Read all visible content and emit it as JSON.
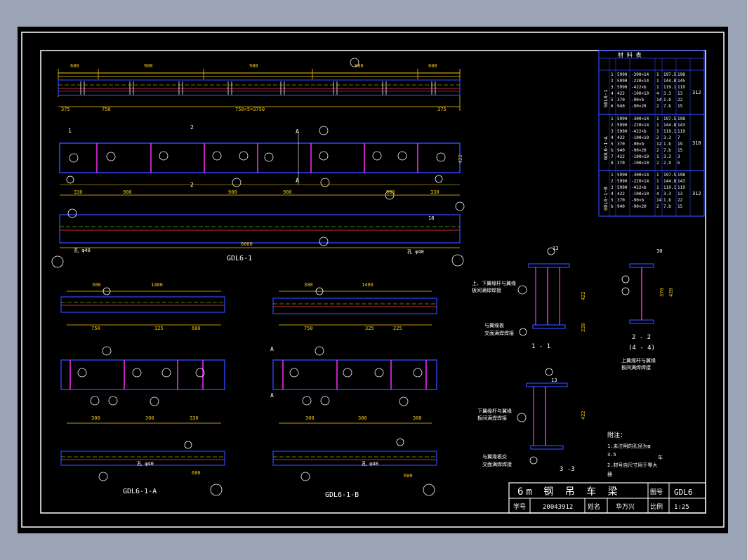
{
  "drawing": {
    "views": {
      "main_label": "GDL6-1",
      "a_label": "GDL6-1-A",
      "b_label": "GDL6-1-B",
      "sec11": "1 - 1",
      "sec22": "2 - 2",
      "sec44": "(4 - 4)",
      "sec33": "3 -3"
    },
    "notes": {
      "title": "附注：",
      "line1": "1.未注明的孔径为φ",
      "line2": "3.5",
      "line2b": "车",
      "line3": "2.材号自尺寸用于零大",
      "line4": "器"
    },
    "callouts": {
      "weld1a": "上、下翼缘杆与翼缘",
      "weld1b": "板间满焊焊接",
      "weld2a": "与翼缘板",
      "weld2b": "交面满焊焊接",
      "weld3a": "上翼缘杆与翼缘",
      "weld3b": "板间满焊焊接",
      "weld4a": "下翼缘杆与翼缘",
      "weld4b": "板间满焊焊接",
      "weld5a": "与翼缘板交",
      "weld5b": "交面满焊焊接",
      "hole": "孔 φ40"
    },
    "table": {
      "title": "材 料 表",
      "groups": [
        "GDL6-1",
        "GDL6-1-A",
        "GDL6-1-B"
      ],
      "group_totals": [
        "312",
        "310",
        "312"
      ],
      "rows_g1": [
        [
          "1",
          "5990",
          "-300×14",
          "1",
          "197.5",
          "198"
        ],
        [
          "2",
          "5990",
          "-220×14",
          "1",
          "144.8",
          "145"
        ],
        [
          "3",
          "5990",
          "-422×b",
          "1",
          "119.1",
          "119"
        ],
        [
          "4",
          "422",
          "-100×10",
          "4",
          "3.3",
          "13"
        ],
        [
          "5",
          "370",
          "-90×b",
          "14",
          "1.b",
          "22"
        ],
        [
          "6",
          "940",
          "-90×20",
          "2",
          "7.b",
          "15"
        ]
      ],
      "rows_g2": [
        [
          "1",
          "5990",
          "-300×14",
          "1",
          "197.5",
          "198"
        ],
        [
          "2",
          "5990",
          "-220×14",
          "1",
          "144.8",
          "143"
        ],
        [
          "3",
          "5990",
          "-422×b",
          "1",
          "119.1",
          "119"
        ],
        [
          "4",
          "422",
          "-100×10",
          "2",
          "3.3",
          "7"
        ],
        [
          "5",
          "370",
          "-90×b",
          "12",
          "1.b",
          "19"
        ],
        [
          "b",
          "940",
          "-90×20",
          "2",
          "7.b",
          "15"
        ],
        [
          "7",
          "422",
          "-100×10",
          "1",
          "3.3",
          "3"
        ],
        [
          "8",
          "370",
          "-100×10",
          "2",
          "2.9",
          "b"
        ]
      ],
      "rows_g3": [
        [
          "1",
          "5990",
          "-300×14",
          "1",
          "197.5",
          "198"
        ],
        [
          "2",
          "5990",
          "-220×14",
          "1",
          "144.8",
          "143"
        ],
        [
          "3",
          "5990",
          "-422×b",
          "1",
          "119.1",
          "119"
        ],
        [
          "4",
          "422",
          "-100×10",
          "4",
          "3.3",
          "13"
        ],
        [
          "5",
          "370",
          "-90×b",
          "14",
          "1.b",
          "22"
        ],
        [
          "b",
          "940",
          "-90×20",
          "2",
          "7.b",
          "15"
        ]
      ]
    },
    "title_block": {
      "title": "6m 钢 吊 车 梁",
      "drawing_no_label": "图号",
      "drawing_no": "GDL6",
      "student_no_label": "学号",
      "student_no": "20043912",
      "name_label": "姓名",
      "name": "华万兴",
      "scale_label": "比例",
      "scale": "1:25"
    },
    "dims": {
      "top_a": "600",
      "top_b": "900",
      "top_c": "750×5=3750",
      "top_d": "375",
      "top_e": "750",
      "bot_d": "6000",
      "w300": "300",
      "w1400": "1400",
      "w325": "325",
      "w225": "225",
      "h422": "422",
      "h220": "220",
      "h30": "30",
      "h370": "370",
      "h420": "420",
      "d13": "13",
      "d18": "18"
    }
  }
}
